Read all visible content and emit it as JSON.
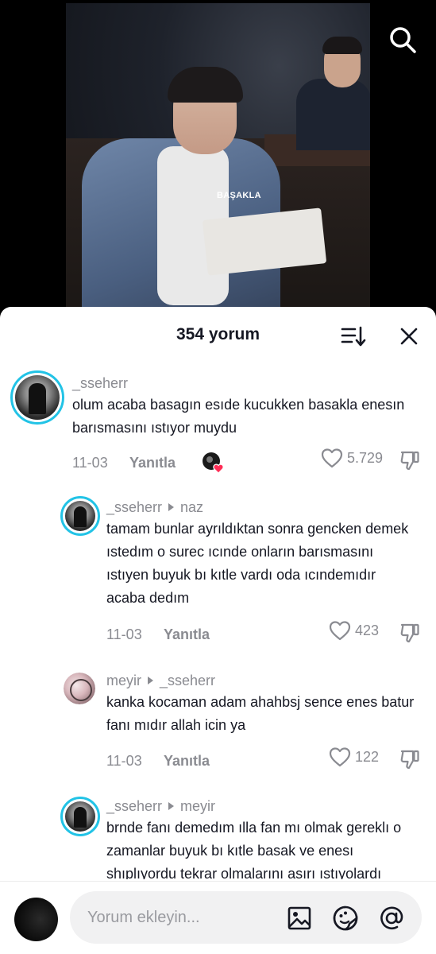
{
  "video": {
    "overlay_text": "BAŞAKLA"
  },
  "sheet": {
    "title": "354 yorum"
  },
  "comments": [
    {
      "username": "_sseherr",
      "reply_to": "",
      "text": "olum acaba basagın esıde kucukken basakla enesın barısmasını ıstıyor muydu",
      "date": "11-03",
      "reply_label": "Yanıtla",
      "likes": "5.729",
      "creator_liked": true
    },
    {
      "username": "_sseherr",
      "reply_to": "naz",
      "text": "tamam bunlar ayrıldıktan sonra gencken demek ıstedım o surec ıcınde onların barısmasını ıstıyen buyuk bı kıtle vardı oda ıcındemıdır acaba dedım",
      "date": "11-03",
      "reply_label": "Yanıtla",
      "likes": "423"
    },
    {
      "username": "meyir",
      "reply_to": "_sseherr",
      "text": "kanka kocaman adam ahahbsj sence enes batur fanı mıdır allah icin ya",
      "date": "11-03",
      "reply_label": "Yanıtla",
      "likes": "122"
    },
    {
      "username": "_sseherr",
      "reply_to": "meyir",
      "text": "brnde fanı demedım ılla fan mı olmak gereklı o zamanlar buyuk bı kıtle basak ve enesı shıplıyordu tekrar olmalarını asırı ıstıyolardı"
    }
  ],
  "input": {
    "placeholder": "Yorum ekleyin..."
  },
  "icons": {
    "search": "search-icon",
    "sort": "sort-icon",
    "close": "close-icon",
    "like": "heart-icon",
    "dislike": "thumbs-down-icon",
    "image": "image-icon",
    "emoji": "emoji-icon",
    "mention": "at-icon"
  },
  "colors": {
    "accent_ring": "#22c3e6",
    "creator_heart": "#fe2c55",
    "muted_text": "#8a8b91"
  }
}
